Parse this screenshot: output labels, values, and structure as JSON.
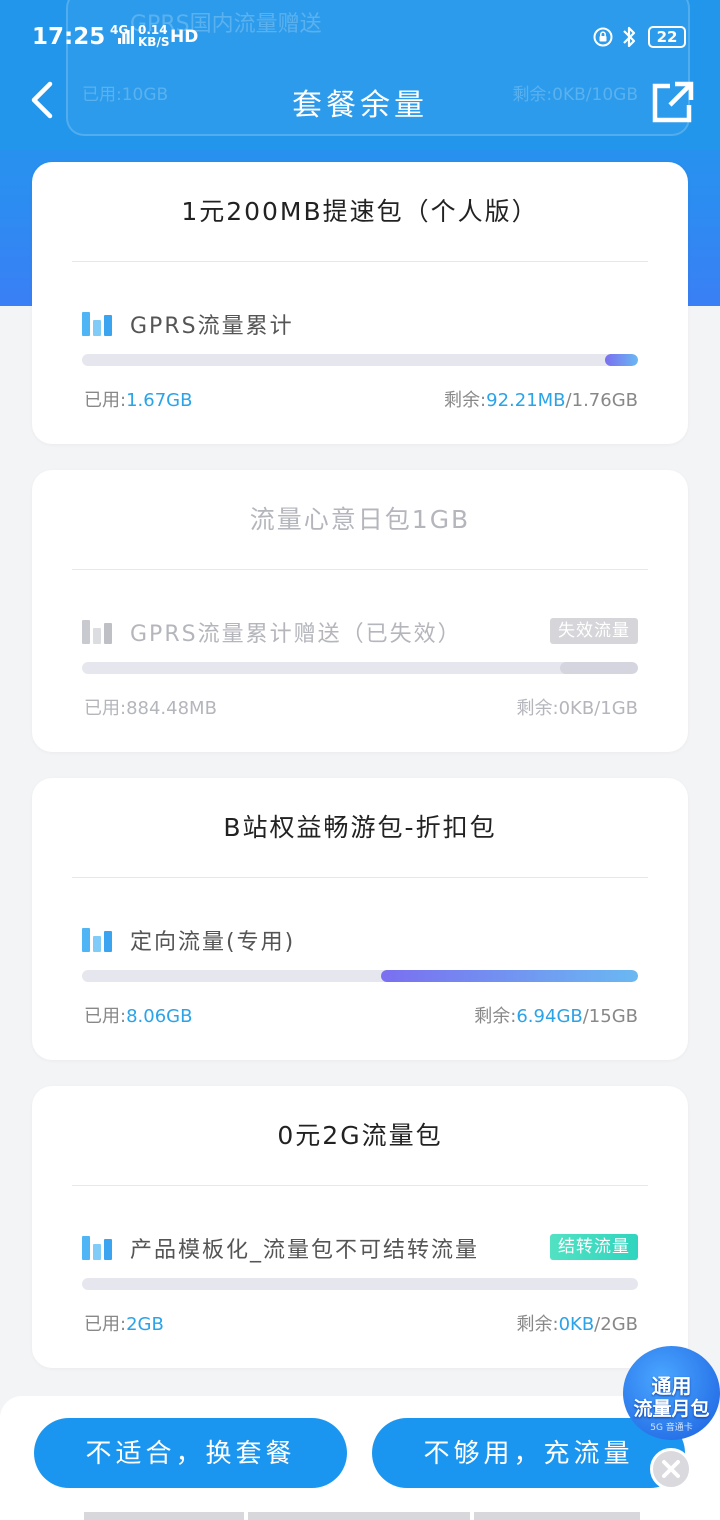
{
  "status_bar": {
    "time": "17:25",
    "network": "4G",
    "speed_value": "0.14",
    "speed_unit": "KB/S",
    "hd": "HD",
    "battery": "22"
  },
  "ghost_card": {
    "title": "GPRS国内流量赠送",
    "used": "已用:10GB",
    "remain": "剩余:0KB/10GB"
  },
  "nav": {
    "title": "套餐余量"
  },
  "cards": [
    {
      "title": "1元200MB提速包（个人版）",
      "item_label": "GPRS流量累计",
      "tag": "",
      "used_prefix": "已用:",
      "used_value": "1.67GB",
      "remain_prefix": "剩余:",
      "remain_value": "92.21MB",
      "remain_total": "/1.76GB",
      "remaining_fraction": 0.06,
      "expired": false
    },
    {
      "title": "流量心意日包1GB",
      "item_label": "GPRS流量累计赠送（已失效）",
      "tag": "失效流量",
      "used_prefix": "已用:",
      "used_value": "884.48MB",
      "remain_prefix": "剩余:",
      "remain_value": "0KB",
      "remain_total": "/1GB",
      "remaining_fraction": 0.14,
      "expired": true
    },
    {
      "title": "B站权益畅游包-折扣包",
      "item_label": "定向流量(专用)",
      "tag": "",
      "used_prefix": "已用:",
      "used_value": "8.06GB",
      "remain_prefix": "剩余:",
      "remain_value": "6.94GB",
      "remain_total": "/15GB",
      "remaining_fraction": 0.4627,
      "expired": false
    },
    {
      "title": "0元2G流量包",
      "item_label": "产品模板化_流量包不可结转流量",
      "tag": "结转流量",
      "used_prefix": "已用:",
      "used_value": "2GB",
      "remain_prefix": "剩余:",
      "remain_value": "0KB",
      "remain_total": "/2GB",
      "remaining_fraction": 0,
      "expired": false
    }
  ],
  "buttons": {
    "change_plan": "不适合，换套餐",
    "recharge": "不够用，充流量"
  },
  "promo": {
    "line1": "通用",
    "line2": "流量月包",
    "line3": "5G 音通卡"
  },
  "colors": {
    "header_blue": "#2196ea",
    "accent_blue": "#2ba3e8",
    "button_blue": "#1b96f0",
    "tag_green": "#3fdcc0",
    "tag_gray": "#d6d6da"
  }
}
